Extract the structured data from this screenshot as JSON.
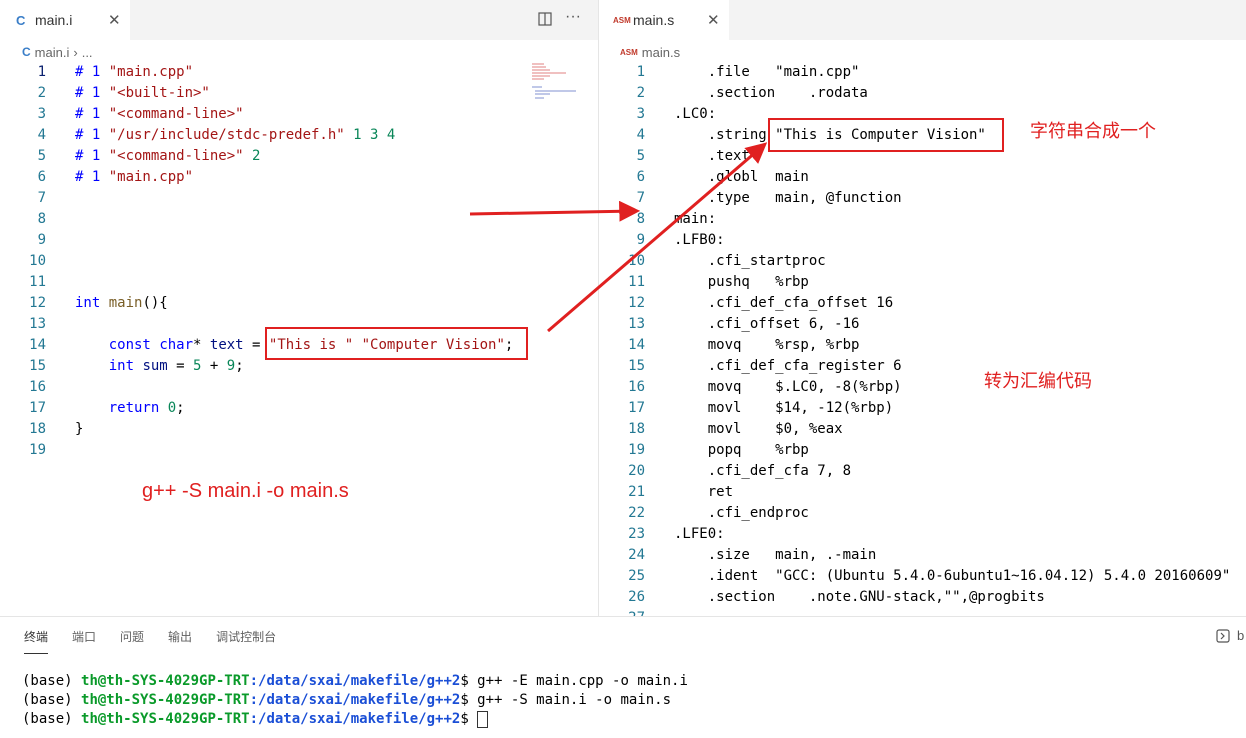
{
  "left_editor": {
    "tab": {
      "icon_text": "C",
      "label": "main.i"
    },
    "breadcrumb": {
      "file": "main.i",
      "rest": "..."
    },
    "lines": [
      {
        "n": "1",
        "tokens": [
          {
            "c": "t-pre",
            "t": "# 1 "
          },
          {
            "c": "t-str",
            "t": "\"main.cpp\""
          }
        ]
      },
      {
        "n": "2",
        "tokens": [
          {
            "c": "t-pre",
            "t": "# 1 "
          },
          {
            "c": "t-str",
            "t": "\"<built-in>\""
          }
        ]
      },
      {
        "n": "3",
        "tokens": [
          {
            "c": "t-pre",
            "t": "# 1 "
          },
          {
            "c": "t-str",
            "t": "\"<command-line>\""
          }
        ]
      },
      {
        "n": "4",
        "tokens": [
          {
            "c": "t-pre",
            "t": "# 1 "
          },
          {
            "c": "t-str",
            "t": "\"/usr/include/stdc-predef.h\""
          },
          {
            "c": "t-num",
            "t": " 1 3 4"
          }
        ]
      },
      {
        "n": "5",
        "tokens": [
          {
            "c": "t-pre",
            "t": "# 1 "
          },
          {
            "c": "t-str",
            "t": "\"<command-line>\""
          },
          {
            "c": "t-num",
            "t": " 2"
          }
        ]
      },
      {
        "n": "6",
        "tokens": [
          {
            "c": "t-pre",
            "t": "# 1 "
          },
          {
            "c": "t-str",
            "t": "\"main.cpp\""
          }
        ]
      },
      {
        "n": "7",
        "tokens": []
      },
      {
        "n": "8",
        "tokens": []
      },
      {
        "n": "9",
        "tokens": []
      },
      {
        "n": "10",
        "tokens": []
      },
      {
        "n": "11",
        "tokens": []
      },
      {
        "n": "12",
        "tokens": [
          {
            "c": "t-kw",
            "t": "int"
          },
          {
            "c": "t-plain",
            "t": " "
          },
          {
            "c": "t-fn",
            "t": "main"
          },
          {
            "c": "t-plain",
            "t": "(){"
          }
        ]
      },
      {
        "n": "13",
        "tokens": []
      },
      {
        "n": "14",
        "tokens": [
          {
            "c": "t-plain",
            "t": "    "
          },
          {
            "c": "t-kw",
            "t": "const"
          },
          {
            "c": "t-plain",
            "t": " "
          },
          {
            "c": "t-kw",
            "t": "char"
          },
          {
            "c": "t-plain",
            "t": "* "
          },
          {
            "c": "t-var",
            "t": "text"
          },
          {
            "c": "t-plain",
            "t": " = "
          },
          {
            "c": "t-str",
            "t": "\"This is \" \"Computer Vision\""
          },
          {
            "c": "t-plain",
            "t": ";"
          }
        ]
      },
      {
        "n": "15",
        "tokens": [
          {
            "c": "t-plain",
            "t": "    "
          },
          {
            "c": "t-kw",
            "t": "int"
          },
          {
            "c": "t-plain",
            "t": " "
          },
          {
            "c": "t-var",
            "t": "sum"
          },
          {
            "c": "t-plain",
            "t": " = "
          },
          {
            "c": "t-num",
            "t": "5"
          },
          {
            "c": "t-plain",
            "t": " + "
          },
          {
            "c": "t-num",
            "t": "9"
          },
          {
            "c": "t-plain",
            "t": ";"
          }
        ]
      },
      {
        "n": "16",
        "tokens": []
      },
      {
        "n": "17",
        "tokens": [
          {
            "c": "t-plain",
            "t": "    "
          },
          {
            "c": "t-kw",
            "t": "return"
          },
          {
            "c": "t-plain",
            "t": " "
          },
          {
            "c": "t-num",
            "t": "0"
          },
          {
            "c": "t-plain",
            "t": ";"
          }
        ]
      },
      {
        "n": "18",
        "tokens": [
          {
            "c": "t-plain",
            "t": "}"
          }
        ]
      },
      {
        "n": "19",
        "tokens": []
      }
    ],
    "annotation_command": "g++ -S main.i -o main.s"
  },
  "right_editor": {
    "tab": {
      "icon_text": "ASM",
      "label": "main.s"
    },
    "breadcrumb": {
      "icon_text": "ASM",
      "file": "main.s"
    },
    "lines": [
      {
        "n": "1",
        "text": "    .file   \"main.cpp\""
      },
      {
        "n": "2",
        "text": "    .section    .rodata"
      },
      {
        "n": "3",
        "text": ".LC0:"
      },
      {
        "n": "4",
        "text": "    .string \"This is Computer Vision\""
      },
      {
        "n": "5",
        "text": "    .text"
      },
      {
        "n": "6",
        "text": "    .globl  main"
      },
      {
        "n": "7",
        "text": "    .type   main, @function"
      },
      {
        "n": "8",
        "text": "main:"
      },
      {
        "n": "9",
        "text": ".LFB0:"
      },
      {
        "n": "10",
        "text": "    .cfi_startproc"
      },
      {
        "n": "11",
        "text": "    pushq   %rbp"
      },
      {
        "n": "12",
        "text": "    .cfi_def_cfa_offset 16"
      },
      {
        "n": "13",
        "text": "    .cfi_offset 6, -16"
      },
      {
        "n": "14",
        "text": "    movq    %rsp, %rbp"
      },
      {
        "n": "15",
        "text": "    .cfi_def_cfa_register 6"
      },
      {
        "n": "16",
        "text": "    movq    $.LC0, -8(%rbp)"
      },
      {
        "n": "17",
        "text": "    movl    $14, -12(%rbp)"
      },
      {
        "n": "18",
        "text": "    movl    $0, %eax"
      },
      {
        "n": "19",
        "text": "    popq    %rbp"
      },
      {
        "n": "20",
        "text": "    .cfi_def_cfa 7, 8"
      },
      {
        "n": "21",
        "text": "    ret"
      },
      {
        "n": "22",
        "text": "    .cfi_endproc"
      },
      {
        "n": "23",
        "text": ".LFE0:"
      },
      {
        "n": "24",
        "text": "    .size   main, .-main"
      },
      {
        "n": "25",
        "text": "    .ident  \"GCC: (Ubuntu 5.4.0-6ubuntu1~16.04.12) 5.4.0 20160609\""
      },
      {
        "n": "26",
        "text": "    .section    .note.GNU-stack,\"\",@progbits"
      },
      {
        "n": "27",
        "text": ""
      }
    ],
    "annotation_merge": "字符串合成一个",
    "annotation_asm": "转为汇编代码"
  },
  "panel": {
    "tabs": [
      "终端",
      "端口",
      "问题",
      "输出",
      "调试控制台"
    ],
    "right_label": "b",
    "terminal_lines": [
      {
        "prefix": "(base) ",
        "user": "th@th-SYS-4029GP-TRT",
        "path": ":/data/sxai/makefile/g++2",
        "prompt": "$ ",
        "cmd": "g++ -E main.cpp -o main.i"
      },
      {
        "prefix": "(base) ",
        "user": "th@th-SYS-4029GP-TRT",
        "path": ":/data/sxai/makefile/g++2",
        "prompt": "$ ",
        "cmd": "g++ -S main.i -o main.s"
      },
      {
        "prefix": "(base) ",
        "user": "th@th-SYS-4029GP-TRT",
        "path": ":/data/sxai/makefile/g++2",
        "prompt": "$ ",
        "cmd": ""
      }
    ]
  },
  "colors": {
    "annotation_red": "#e02020",
    "line_number": "#237893",
    "string": "#a31515",
    "keyword": "#0000ff"
  },
  "icons": [
    "split-editor-icon",
    "more-actions-icon",
    "close-icon",
    "chevron-right-icon",
    "panel-maximize-icon"
  ]
}
